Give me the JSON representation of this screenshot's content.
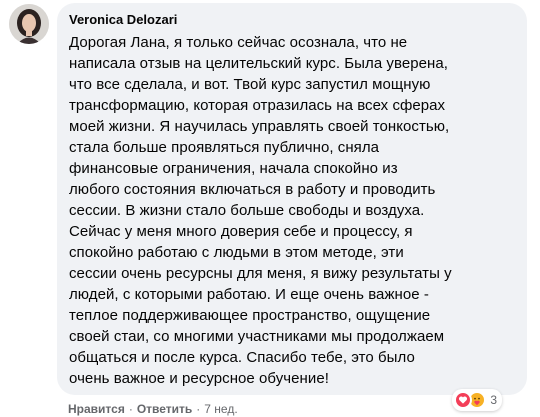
{
  "comment": {
    "author": "Veronica Delozari",
    "text": "Дорогая Лана, я только сейчас осознала, что не\nнаписала отзыв на целительский курс. Была уверена,\nчто все сделала, и вот. Твой курс запустил мощную\nтрансформацию, которая отразилась на всех сферах\nмоей жизни. Я научилась управлять своей тонкостью,\nстала больше проявляться публично, сняла\nфинансовые ограничения, начала спокойно из\nлюбого состояния включаться в работу и проводить\nсессии. В жизни стало больше свободы и воздуха.\nСейчас у меня много доверия себе и процессу, я\nспокойно работаю с людьми в этом методе, эти\nсессии очень ресурсны для меня, я вижу результаты у\nлюдей, с которыми работаю. И еще очень важное -\nтеплое поддерживающее пространство, ощущение\nсвоей стаи, со многими участниками мы продолжаем\nобщаться и после курса. Спасибо тебе, это было\nочень важное и ресурсное обучение!",
    "reactions": {
      "icons": [
        "love-icon",
        "care-icon"
      ],
      "count": "3"
    }
  },
  "actions": {
    "like": "Нравится",
    "separator": "·",
    "reply": "Ответить",
    "time": "7 нед."
  },
  "colors": {
    "bubble": "#f0f2f5",
    "text": "#050505",
    "secondary": "#65676b",
    "love": "#f33e58",
    "care": "#f7b125"
  }
}
